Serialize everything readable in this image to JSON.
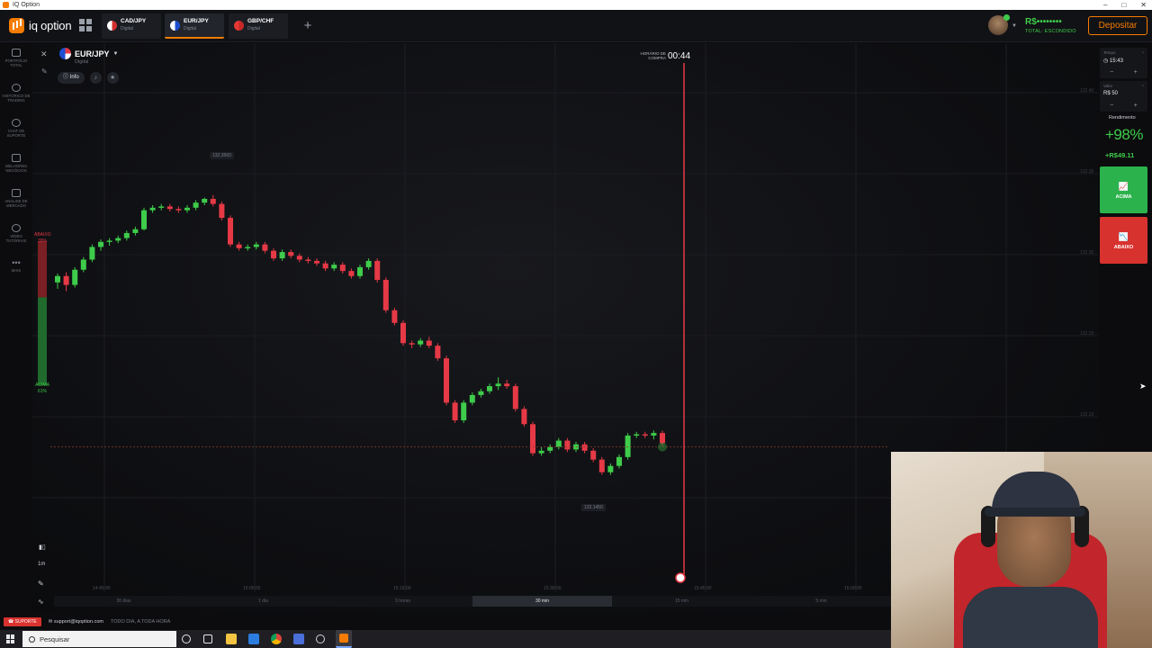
{
  "window": {
    "title": "IQ Option"
  },
  "topbar": {
    "logo_text": "iq option",
    "tabs": [
      {
        "name": "CAD/JPY",
        "sub": "Digital",
        "flag_color": "#d32f2f"
      },
      {
        "name": "EUR/JPY",
        "sub": "Digital",
        "flag_color": "#1e4fd1"
      },
      {
        "name": "GBP/CHF",
        "sub": "Digital",
        "flag_color": "#c62828"
      }
    ],
    "balance_amount": "R$••••••••",
    "balance_label": "TOTAL: ESCONDIDO",
    "deposit_label": "Depositar"
  },
  "sidebar": {
    "items": [
      {
        "label": "PORTFÓLIO TOTAL",
        "icon": "briefcase-icon"
      },
      {
        "label": "HISTÓRICO DE TRADING",
        "icon": "history-icon"
      },
      {
        "label": "CHAT DE SUPORTE",
        "icon": "chat-icon"
      },
      {
        "label": "MELHORES NEGÓCIOS",
        "icon": "trophy-icon"
      },
      {
        "label": "ANÁLISE DE MERCADO",
        "icon": "news-icon"
      },
      {
        "label": "VÍDEO TUTORIAIS",
        "icon": "play-icon"
      },
      {
        "label": "MAIS",
        "icon": "more-icon"
      }
    ],
    "timeframe_label": "1m"
  },
  "asset": {
    "name": "EUR/JPY",
    "sub": "Digital",
    "info_label": "Info"
  },
  "chart_overlay": {
    "timer_label": "HORÁRIO DE COMPRA",
    "timer_value": "00:44",
    "down_label": "ABAIXO",
    "down_pct": "39%",
    "up_label": "ACIMA",
    "up_pct": "61%",
    "high_price": "132.3560",
    "low_price": "132.1450",
    "y_ticks": [
      "132.40",
      "132.35",
      "132.30",
      "132.25",
      "132.20"
    ],
    "x_ticks": [
      "14:45:00",
      "15:00:00",
      "15:15:00",
      "15:30:00",
      "15:45:00",
      "16:00:00"
    ]
  },
  "trade_panel": {
    "time_label": "Tempo",
    "time_value": "15:43",
    "amount_label": "Valor",
    "amount_value": "R$ 50",
    "yield_label": "Rendimento",
    "yield_pct": "+98%",
    "yield_amount": "+R$49.11",
    "up_button": "ACIMA",
    "down_button": "ABAIXO"
  },
  "timeframes": [
    "30 dias",
    "1 dia",
    "3 horas",
    "30 min",
    "15 min",
    "5 min"
  ],
  "active_timeframe": "30 min",
  "support": {
    "button": "SUPORTE",
    "email": "support@iqoption.com",
    "note": "TODO DIA, A TODA HORA"
  },
  "taskbar": {
    "search_placeholder": "Pesquisar"
  },
  "colors": {
    "accent": "#f57c00",
    "up": "#3ecc4a",
    "down": "#e63946",
    "up_button": "#2bb24c",
    "down_button": "#d8322f"
  },
  "chart_data": {
    "type": "candlestick",
    "ylim": [
      132.1,
      132.42
    ],
    "candles": [
      [
        132.295,
        132.3,
        132.29,
        132.302
      ],
      [
        132.3,
        132.293,
        132.288,
        132.303
      ],
      [
        132.293,
        132.305,
        132.291,
        132.307
      ],
      [
        132.305,
        132.313,
        132.303,
        132.315
      ],
      [
        132.313,
        132.323,
        132.311,
        132.325
      ],
      [
        132.323,
        132.327,
        132.32,
        132.329
      ],
      [
        132.327,
        132.328,
        132.324,
        132.33
      ],
      [
        132.328,
        132.33,
        132.326,
        132.332
      ],
      [
        132.33,
        132.334,
        132.328,
        132.336
      ],
      [
        132.334,
        132.337,
        132.332,
        132.339
      ],
      [
        132.337,
        132.352,
        132.336,
        132.354
      ],
      [
        132.352,
        132.354,
        132.35,
        132.356
      ],
      [
        132.354,
        132.355,
        132.352,
        132.357
      ],
      [
        132.355,
        132.353,
        132.351,
        132.357
      ],
      [
        132.353,
        132.352,
        132.35,
        132.355
      ],
      [
        132.352,
        132.354,
        132.35,
        132.356
      ],
      [
        132.354,
        132.358,
        132.352,
        132.36
      ],
      [
        132.358,
        132.361,
        132.356,
        132.362
      ],
      [
        132.361,
        132.357,
        132.355,
        132.364
      ],
      [
        132.357,
        132.346,
        132.344,
        132.359
      ],
      [
        132.346,
        132.325,
        132.323,
        132.348
      ],
      [
        132.325,
        132.322,
        132.32,
        132.327
      ],
      [
        132.322,
        132.323,
        132.32,
        132.325
      ],
      [
        132.323,
        132.325,
        132.321,
        132.327
      ],
      [
        132.325,
        132.32,
        132.318,
        132.327
      ],
      [
        132.32,
        132.314,
        132.312,
        132.322
      ],
      [
        132.314,
        132.319,
        132.312,
        132.321
      ],
      [
        132.319,
        132.316,
        132.314,
        132.321
      ],
      [
        132.316,
        132.313,
        132.311,
        132.318
      ],
      [
        132.313,
        132.312,
        132.31,
        132.315
      ],
      [
        132.312,
        132.31,
        132.308,
        132.314
      ],
      [
        132.31,
        132.306,
        132.304,
        132.312
      ],
      [
        132.306,
        132.309,
        132.304,
        132.311
      ],
      [
        132.309,
        132.304,
        132.302,
        132.311
      ],
      [
        132.304,
        132.3,
        132.298,
        132.306
      ],
      [
        132.3,
        132.307,
        132.298,
        132.309
      ],
      [
        132.307,
        132.312,
        132.305,
        132.314
      ],
      [
        132.312,
        132.297,
        132.295,
        132.314
      ],
      [
        132.297,
        132.273,
        132.271,
        132.299
      ],
      [
        132.273,
        132.263,
        132.261,
        132.275
      ],
      [
        132.263,
        132.247,
        132.245,
        132.265
      ],
      [
        132.247,
        132.246,
        132.243,
        132.249
      ],
      [
        132.246,
        132.249,
        132.244,
        132.251
      ],
      [
        132.249,
        132.245,
        132.243,
        132.252
      ],
      [
        132.245,
        132.235,
        132.233,
        132.247
      ],
      [
        132.235,
        132.2,
        132.198,
        132.237
      ],
      [
        132.2,
        132.186,
        132.184,
        132.202
      ],
      [
        132.186,
        132.2,
        132.184,
        132.202
      ],
      [
        132.2,
        132.206,
        132.198,
        132.208
      ],
      [
        132.206,
        132.209,
        132.204,
        132.211
      ],
      [
        132.209,
        132.213,
        132.207,
        132.215
      ],
      [
        132.213,
        132.215,
        132.21,
        132.22
      ],
      [
        132.215,
        132.213,
        132.211,
        132.218
      ],
      [
        132.213,
        132.195,
        132.193,
        132.215
      ],
      [
        132.195,
        132.183,
        132.181,
        132.197
      ],
      [
        132.183,
        132.16,
        132.158,
        132.185
      ],
      [
        132.16,
        132.162,
        132.158,
        132.165
      ],
      [
        132.162,
        132.165,
        132.16,
        132.167
      ],
      [
        132.165,
        132.17,
        132.163,
        132.172
      ],
      [
        132.17,
        132.163,
        132.161,
        132.172
      ],
      [
        132.163,
        132.167,
        132.161,
        132.169
      ],
      [
        132.167,
        132.162,
        132.16,
        132.169
      ],
      [
        132.162,
        132.155,
        132.153,
        132.164
      ],
      [
        132.155,
        132.145,
        132.143,
        132.157
      ],
      [
        132.145,
        132.15,
        132.143,
        132.152
      ],
      [
        132.15,
        132.157,
        132.148,
        132.159
      ],
      [
        132.157,
        132.174,
        132.155,
        132.176
      ],
      [
        132.174,
        132.175,
        132.172,
        132.177
      ],
      [
        132.175,
        132.174,
        132.172,
        132.177
      ],
      [
        132.174,
        132.176,
        132.171,
        132.178
      ],
      [
        132.176,
        132.168,
        132.166,
        132.178
      ]
    ],
    "current_price": 132.165,
    "up_pct": 61,
    "down_pct": 39
  }
}
